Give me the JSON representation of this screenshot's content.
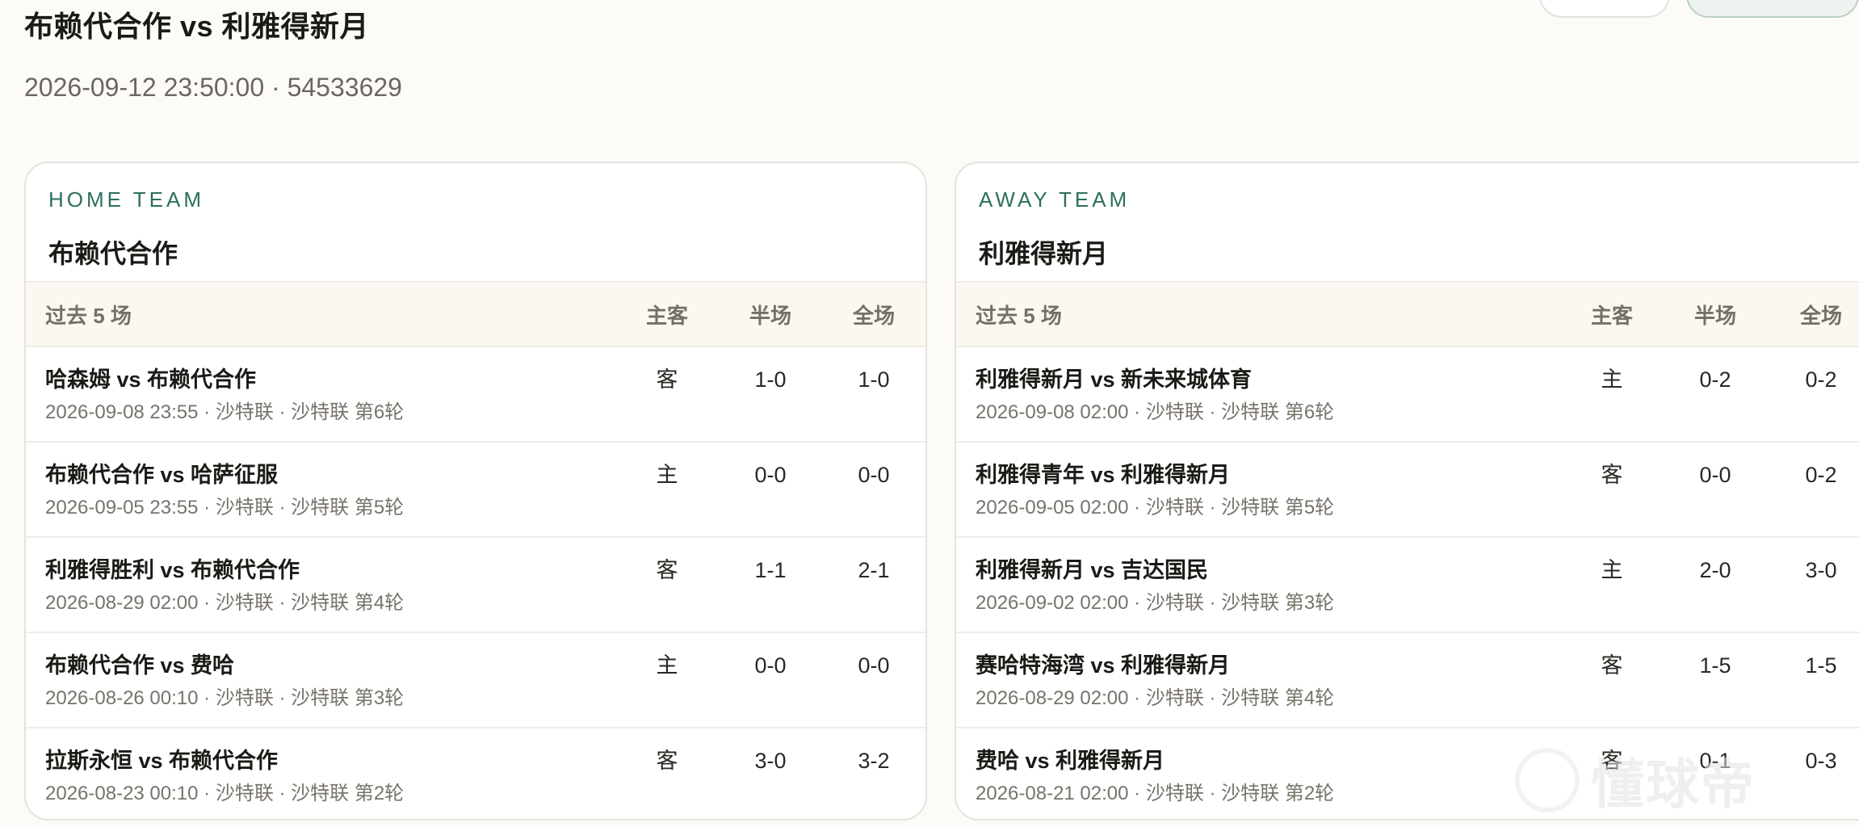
{
  "match": {
    "title": "布赖代合作 vs 利雅得新月",
    "meta": "2026-09-12 23:50:00 · 54533629"
  },
  "columns": {
    "history": "过去 5 场",
    "home_away": "主客",
    "half": "半场",
    "full": "全场"
  },
  "home": {
    "kicker": "HOME TEAM",
    "team": "布赖代合作",
    "rows": [
      {
        "name": "哈森姆 vs 布赖代合作",
        "sub": "2026-09-08 23:55 · 沙特联 · 沙特联 第6轮",
        "ha": "客",
        "half": "1-0",
        "full": "1-0"
      },
      {
        "name": "布赖代合作 vs 哈萨征服",
        "sub": "2026-09-05 23:55 · 沙特联 · 沙特联 第5轮",
        "ha": "主",
        "half": "0-0",
        "full": "0-0"
      },
      {
        "name": "利雅得胜利 vs 布赖代合作",
        "sub": "2026-08-29 02:00 · 沙特联 · 沙特联 第4轮",
        "ha": "客",
        "half": "1-1",
        "full": "2-1"
      },
      {
        "name": "布赖代合作 vs 费哈",
        "sub": "2026-08-26 00:10 · 沙特联 · 沙特联 第3轮",
        "ha": "主",
        "half": "0-0",
        "full": "0-0"
      },
      {
        "name": "拉斯永恒 vs 布赖代合作",
        "sub": "2026-08-23 00:10 · 沙特联 · 沙特联 第2轮",
        "ha": "客",
        "half": "3-0",
        "full": "3-2"
      }
    ]
  },
  "away": {
    "kicker": "AWAY TEAM",
    "team": "利雅得新月",
    "rows": [
      {
        "name": "利雅得新月 vs 新未来城体育",
        "sub": "2026-09-08 02:00 · 沙特联 · 沙特联 第6轮",
        "ha": "主",
        "half": "0-2",
        "full": "0-2"
      },
      {
        "name": "利雅得青年 vs 利雅得新月",
        "sub": "2026-09-05 02:00 · 沙特联 · 沙特联 第5轮",
        "ha": "客",
        "half": "0-0",
        "full": "0-2"
      },
      {
        "name": "利雅得新月 vs 吉达国民",
        "sub": "2026-09-02 02:00 · 沙特联 · 沙特联 第3轮",
        "ha": "主",
        "half": "2-0",
        "full": "3-0"
      },
      {
        "name": "赛哈特海湾 vs 利雅得新月",
        "sub": "2026-08-29 02:00 · 沙特联 · 沙特联 第4轮",
        "ha": "客",
        "half": "1-5",
        "full": "1-5"
      },
      {
        "name": "费哈 vs 利雅得新月",
        "sub": "2026-08-21 02:00 · 沙特联 · 沙特联 第2轮",
        "ha": "客",
        "half": "0-1",
        "full": "0-3"
      }
    ]
  },
  "watermark": {
    "text": "懂球帝",
    "icon": "football-logo-icon"
  }
}
